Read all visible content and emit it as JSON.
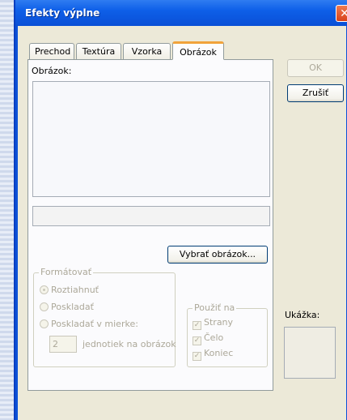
{
  "window": {
    "title": "Efekty výplne",
    "close_glyph": "✕"
  },
  "tabs": [
    {
      "label": "Prechod"
    },
    {
      "label": "Textúra"
    },
    {
      "label": "Vzorka"
    },
    {
      "label": "Obrázok"
    }
  ],
  "picture_tab": {
    "picture_label": "Obrázok:",
    "select_button": "Vybrať obrázok..."
  },
  "format_group": {
    "legend": "Formátovať",
    "options": [
      {
        "label": "Roztiahnuť",
        "checked": true
      },
      {
        "label": "Poskladať",
        "checked": false
      },
      {
        "label": "Poskladať v mierke:",
        "checked": false
      }
    ],
    "units_value": "2",
    "units_label": "jednotiek na obrázok"
  },
  "apply_group": {
    "legend": "Použiť na",
    "options": [
      {
        "label": "Strany",
        "checked": true
      },
      {
        "label": "Čelo",
        "checked": true
      },
      {
        "label": "Koniec",
        "checked": true
      }
    ],
    "check_glyph": "✓"
  },
  "buttons": {
    "ok": "OK",
    "cancel": "Zrušiť"
  },
  "preview": {
    "label": "Ukážka:"
  }
}
